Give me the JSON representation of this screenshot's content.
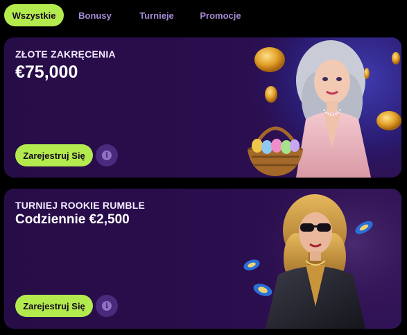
{
  "tabs": [
    {
      "label": "Wszystkie",
      "active": true
    },
    {
      "label": "Bonusy",
      "active": false
    },
    {
      "label": "Turnieje",
      "active": false
    },
    {
      "label": "Promocje",
      "active": false
    }
  ],
  "promos": [
    {
      "title": "ZŁOTE ZAKRĘCENIA",
      "amount": "€75,000",
      "button_label": "Zarejestruj Się",
      "info_icon": "info-icon",
      "illustration": "woman-with-easter-egg-basket-and-gold-coins"
    },
    {
      "title": "TURNIEJ ROOKIE RUMBLE",
      "amount": "Codziennie €2,500",
      "button_label": "Zarejestruj Się",
      "info_icon": "info-icon",
      "illustration": "woman-in-sunglasses-with-casino-chips"
    }
  ],
  "colors": {
    "accent": "#b3ea4e",
    "card_bg": "#270d48",
    "tab_text": "#a58ad6",
    "page_bg": "#000000"
  }
}
